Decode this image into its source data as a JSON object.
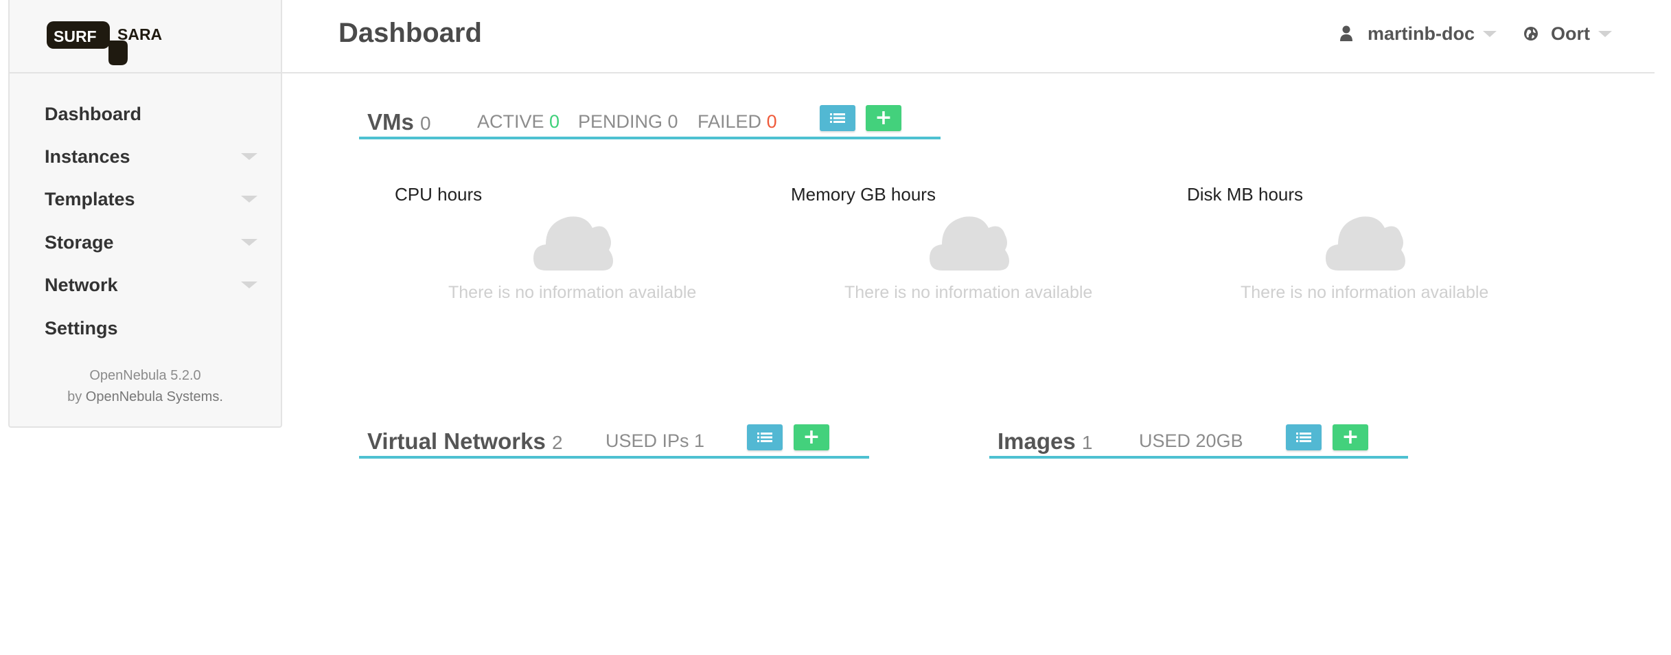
{
  "app": {
    "logo": {
      "left": "SURF",
      "right": "SARA"
    },
    "page_title": "Dashboard"
  },
  "header": {
    "user": {
      "name": "martinb-doc",
      "icon": "user-icon"
    },
    "zone": {
      "name": "Oort",
      "icon": "globe-icon"
    }
  },
  "sidebar": {
    "items": [
      {
        "label": "Dashboard",
        "has_submenu": false
      },
      {
        "label": "Instances",
        "has_submenu": true
      },
      {
        "label": "Templates",
        "has_submenu": true
      },
      {
        "label": "Storage",
        "has_submenu": true
      },
      {
        "label": "Network",
        "has_submenu": true
      },
      {
        "label": "Settings",
        "has_submenu": false
      }
    ],
    "footer": {
      "version": "OpenNebula 5.2.0",
      "by": "by",
      "company": "OpenNebula Systems."
    }
  },
  "vms": {
    "title": "VMs",
    "count": "0",
    "active_label": "ACTIVE",
    "active": "0",
    "pending_label": "PENDING",
    "pending": "0",
    "failed_label": "FAILED",
    "failed": "0"
  },
  "charts": [
    {
      "title": "CPU hours",
      "message": "There is no information available"
    },
    {
      "title": "Memory GB hours",
      "message": "There is no information available"
    },
    {
      "title": "Disk MB hours",
      "message": "There is no information available"
    }
  ],
  "vnets": {
    "title": "Virtual Networks",
    "count": "2",
    "used_label": "USED IPs",
    "used": "1"
  },
  "images": {
    "title": "Images",
    "count": "1",
    "used_label": "USED",
    "used": "20GB"
  },
  "colors": {
    "accent": "#4ec1d1",
    "list_button": "#52b8d3",
    "add_button": "#43d17c",
    "active": "#3fd07a",
    "failed": "#ef5a3a"
  }
}
